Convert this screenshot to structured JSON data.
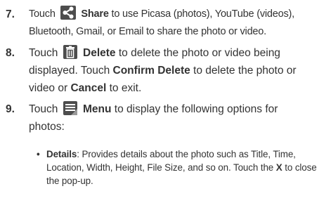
{
  "steps": [
    {
      "number": "7.",
      "pre": "Touch",
      "icon": "share-icon",
      "bold": "Share",
      "post": " to use Picasa (photos), YouTube (videos),",
      "line2": "Bluetooth, Gmail, or Email to share the photo or video."
    },
    {
      "number": "8.",
      "pre": "Touch",
      "icon": "trash-icon",
      "bold": "Delete",
      "post": " to delete the photo or video being",
      "line2": "displayed. Touch ",
      "line2_bold": "Confirm Delete",
      "line2_post": " to delete the photo or",
      "line3": "video or ",
      "line3_bold": "Cancel",
      "line3_post": " to exit."
    },
    {
      "number": "9.",
      "pre": "Touch",
      "icon": "menu-icon",
      "bold": "Menu",
      "post": " to display the following options for",
      "line2": "photos:"
    }
  ],
  "bullet": {
    "term": "Details",
    "text1": ": Provides details about the photo such as Title, Time,",
    "text2": "Location, Width, Height, File Size, and so on. Touch the ",
    "key": "X",
    "text2_post": " to close",
    "text3": "the pop-up."
  },
  "colors": {
    "icon_bg": "#4d4d4d",
    "text": "#333333"
  }
}
